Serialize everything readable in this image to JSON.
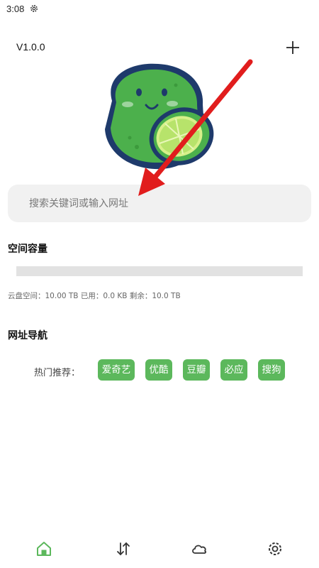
{
  "status_bar": {
    "time": "3:08",
    "icon": "gear-icon"
  },
  "header": {
    "version": "V1.0.0",
    "add_icon": "plus-icon"
  },
  "logo": {
    "icon": "lime-mascot-logo",
    "colors": {
      "outline": "#1e3a6b",
      "lime": "#4cb04c",
      "slice": "#b7e36b"
    }
  },
  "search": {
    "placeholder": "搜索关键词或输入网址",
    "value": ""
  },
  "storage": {
    "title": "空间容量",
    "used_fraction": 0.0,
    "info": "云盘空间：10.00 TB 已用：0.0 KB 剩余：10.0 TB"
  },
  "nav_section": {
    "title": "网址导航",
    "hot_label": "热门推荐：",
    "tags": [
      "爱奇艺",
      "优酷",
      "豆瓣",
      "必应",
      "搜狗"
    ]
  },
  "bottom_nav": [
    {
      "icon": "home-icon",
      "active": true
    },
    {
      "icon": "transfer-icon",
      "active": false
    },
    {
      "icon": "cloud-icon",
      "active": false
    },
    {
      "icon": "settings-icon",
      "active": false
    }
  ],
  "colors": {
    "accent": "#5cb85c",
    "search_bg": "#f1f1f1",
    "annotation_arrow": "#e11d1d"
  }
}
